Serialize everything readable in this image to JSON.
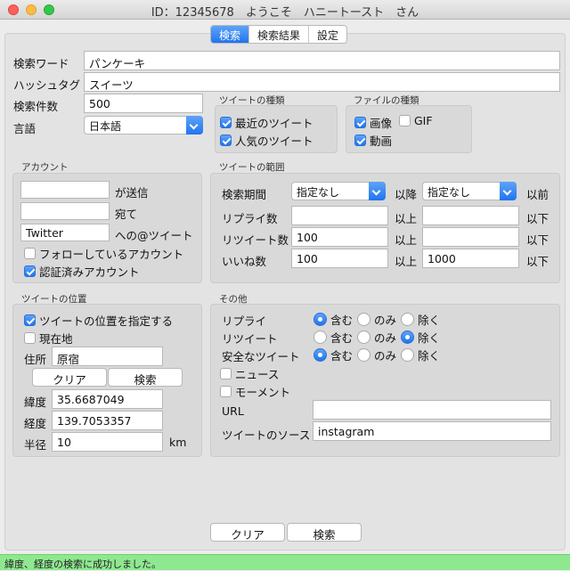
{
  "window": {
    "title": "ID：12345678　ようこそ　ハニートースト　さん"
  },
  "tabs": [
    {
      "label": "検索",
      "active": true
    },
    {
      "label": "検索結果",
      "active": false
    },
    {
      "label": "設定",
      "active": false
    }
  ],
  "search": {
    "keyword_label": "検索ワード",
    "keyword_value": "パンケーキ",
    "hashtag_label": "ハッシュタグ",
    "hashtag_value": "スイーツ",
    "count_label": "検索件数",
    "count_value": "500",
    "language_label": "言語",
    "language_value": "日本語"
  },
  "tweet_type": {
    "title": "ツイートの種類",
    "recent": {
      "label": "最近のツイート",
      "checked": true
    },
    "popular": {
      "label": "人気のツイート",
      "checked": true
    }
  },
  "file_type": {
    "title": "ファイルの種類",
    "image": {
      "label": "画像",
      "checked": true
    },
    "gif": {
      "label": "GIF",
      "checked": false
    },
    "video": {
      "label": "動画",
      "checked": true
    }
  },
  "account": {
    "title": "アカウント",
    "sender_value": "",
    "sender_label": "が送信",
    "recipient_value": "",
    "recipient_label": "宛て",
    "mention_value": "Twitter",
    "mention_label": "への@ツイート",
    "following": {
      "label": "フォローしているアカウント",
      "checked": false
    },
    "verified": {
      "label": "認証済みアカウント",
      "checked": true
    }
  },
  "tweet_range": {
    "title": "ツイートの範囲",
    "period_label": "検索期間",
    "period_from": "指定なし",
    "after_label": "以降",
    "period_to": "指定なし",
    "before_label": "以前",
    "replies_label": "リプライ数",
    "replies_min": "",
    "replies_max": "",
    "retweets_label": "リツイート数",
    "retweets_min": "100",
    "retweets_max": "",
    "likes_label": "いいね数",
    "likes_min": "100",
    "likes_max": "1000",
    "above_label": "以上",
    "below_label": "以下"
  },
  "location": {
    "title": "ツイートの位置",
    "specify": {
      "label": "ツイートの位置を指定する",
      "checked": true
    },
    "current": {
      "label": "現在地",
      "checked": false
    },
    "address_label": "住所",
    "address_value": "原宿",
    "clear_button": "クリア",
    "search_button": "検索",
    "latitude_label": "緯度",
    "latitude_value": "35.6687049",
    "longitude_label": "経度",
    "longitude_value": "139.7053357",
    "radius_label": "半径",
    "radius_value": "10",
    "radius_unit": "km"
  },
  "other": {
    "title": "その他",
    "reply_label": "リプライ",
    "reply_selected": "含む",
    "retweet_label": "リツイート",
    "retweet_selected": "除く",
    "safe_label": "安全なツイート",
    "safe_selected": "含む",
    "option_include": "含む",
    "option_only": "のみ",
    "option_exclude": "除く",
    "news": {
      "label": "ニュース",
      "checked": false
    },
    "moment": {
      "label": "モーメント",
      "checked": false
    },
    "url_label": "URL",
    "url_value": "",
    "source_label": "ツイートのソース",
    "source_value": "instagram"
  },
  "footer": {
    "clear_button": "クリア",
    "search_button": "検索"
  },
  "status": {
    "text": "緯度、経度の検索に成功しました。",
    "color": "#8fe88f"
  },
  "colors": {
    "accent": "#1f75ef",
    "panel": "#e3e3e3"
  }
}
